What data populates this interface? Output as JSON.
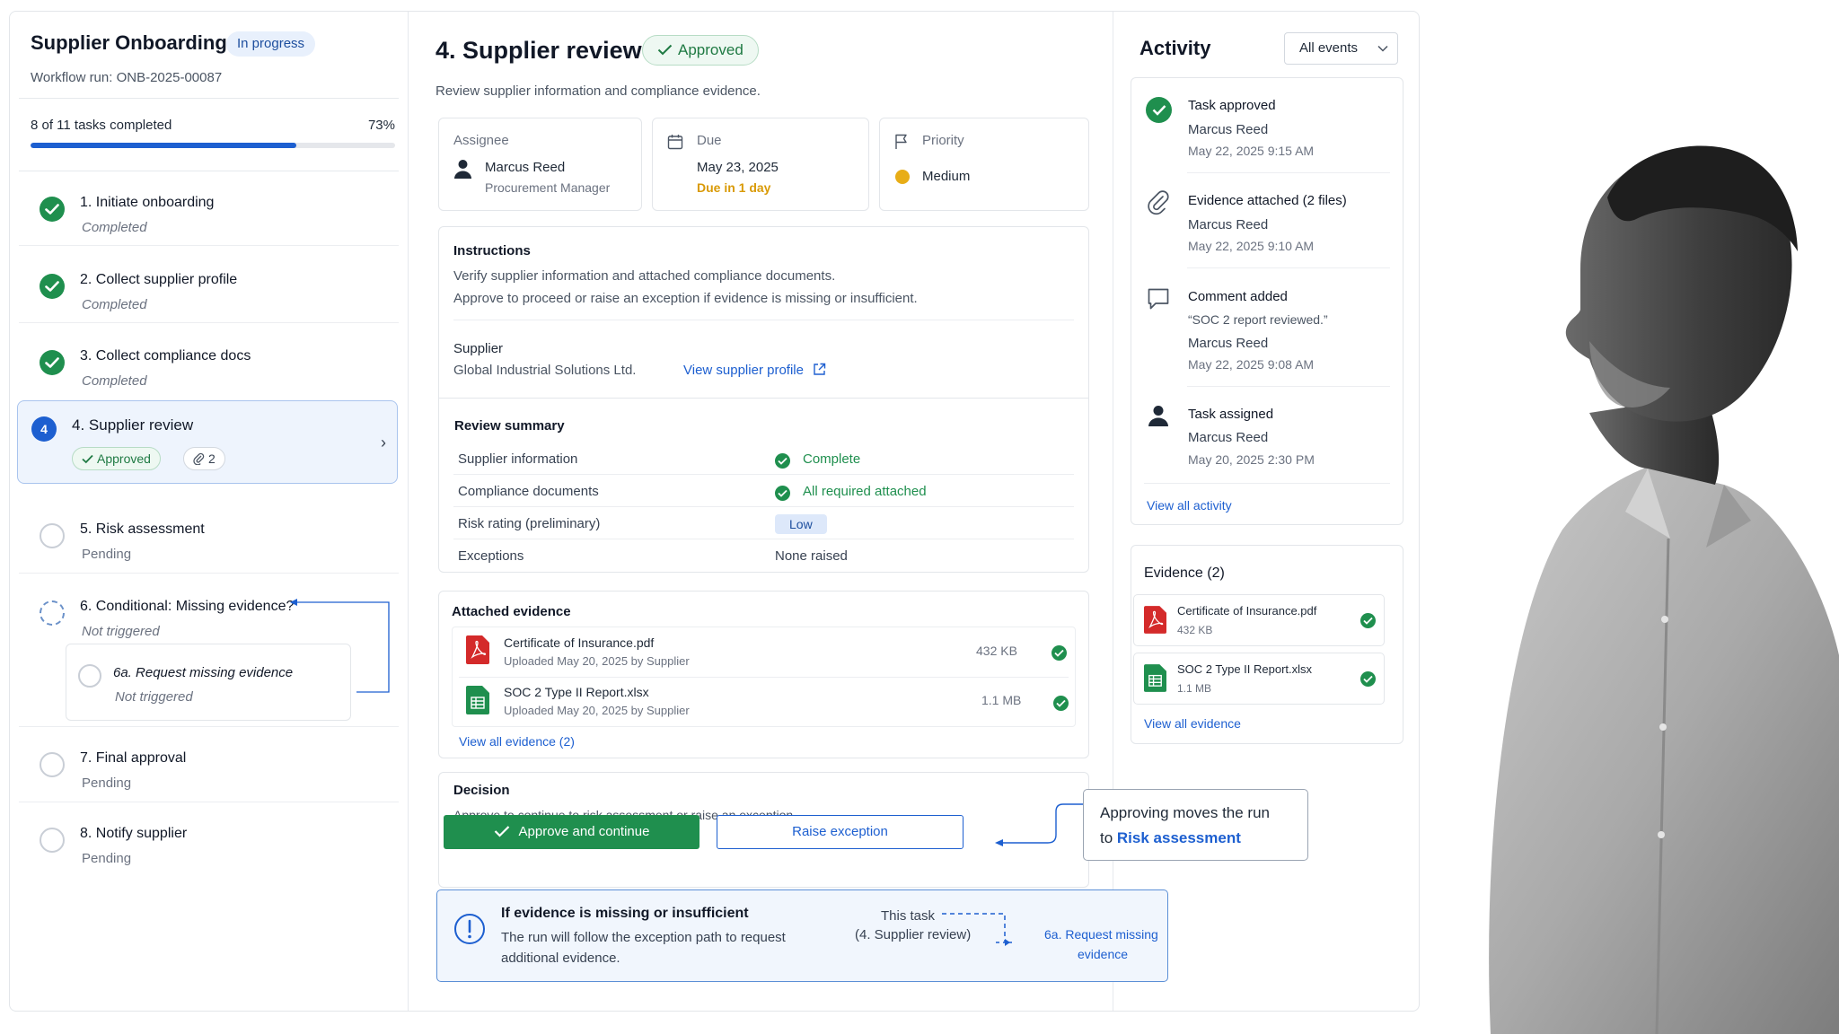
{
  "workflow": {
    "title": "Supplier Onboarding",
    "status": "In progress",
    "run": "Workflow run: ONB-2025-00087",
    "progress_label": "8 of 11 tasks completed",
    "progress_pct": "73%",
    "progress_value": 0.73
  },
  "steps": [
    {
      "title": "1. Initiate onboarding",
      "status": "Completed"
    },
    {
      "title": "2. Collect supplier profile",
      "status": "Completed"
    },
    {
      "title": "3. Collect compliance docs",
      "status": "Completed"
    },
    {
      "title": "4. Supplier review",
      "num": "4",
      "chip": "Approved",
      "attach": "2"
    },
    {
      "title": "5. Risk assessment",
      "status": "Pending"
    },
    {
      "title": "6. Conditional: Missing evidence?",
      "status": "Not triggered"
    },
    {
      "title": "6a. Request missing evidence",
      "status": "Not triggered"
    },
    {
      "title": "7. Final approval",
      "status": "Pending"
    },
    {
      "title": "8. Notify supplier",
      "status": "Pending"
    }
  ],
  "task": {
    "title": "4. Supplier review",
    "status": "Approved",
    "description": "Review supplier information and compliance evidence.",
    "assignee_label": "Assignee",
    "assignee_name": "Marcus Reed",
    "assignee_role": "Procurement Manager",
    "due_label": "Due",
    "due_date": "May 23, 2025",
    "due_in": "Due in 1 day",
    "priority_label": "Priority",
    "priority": "Medium",
    "instructions_title": "Instructions",
    "instructions_1": "Verify supplier information and attached compliance documents.",
    "instructions_2": "Approve to proceed or raise an exception if evidence is missing or insufficient.",
    "supplier_label": "Supplier",
    "supplier_name": "Global Industrial Solutions Ltd.",
    "supplier_link": "View supplier profile",
    "summary_title": "Review summary",
    "summary": [
      {
        "k": "Supplier information",
        "v": "Complete"
      },
      {
        "k": "Compliance documents",
        "v": "All required attached"
      },
      {
        "k": "Risk rating (preliminary)",
        "v": "Low"
      },
      {
        "k": "Exceptions",
        "v": "None raised"
      }
    ],
    "evidence_title": "Attached evidence",
    "evidence": [
      {
        "name": "Certificate of Insurance.pdf",
        "meta": "Uploaded May 20, 2025 by Supplier",
        "size": "432 KB"
      },
      {
        "name": "SOC 2 Type II Report.xlsx",
        "meta": "Uploaded May 20, 2025 by Supplier",
        "size": "1.1 MB"
      }
    ],
    "evidence_link": "View all evidence (2)",
    "decision_title": "Decision",
    "decision_desc": "Approve to continue to risk assessment or raise an exception.",
    "approve_btn": "Approve and continue",
    "raise_btn": "Raise exception"
  },
  "callout": {
    "line1": "Approving moves the run",
    "line2_prefix": "to ",
    "line2_link": "Risk assessment"
  },
  "note": {
    "title": "If evidence is missing or insufficient",
    "body_1": "The run will follow the exception path to request",
    "body_2": "additional evidence.",
    "this_task_1": "This task",
    "this_task_2": "(4. Supplier review)",
    "target_1": "6a. Request missing",
    "target_2": "evidence"
  },
  "activity": {
    "title": "Activity",
    "filter": "All events",
    "items": [
      {
        "title": "Task approved",
        "user": "Marcus Reed",
        "time": "May 22, 2025 9:15 AM",
        "icon": "check-circle-icon"
      },
      {
        "title": "Evidence attached (2 files)",
        "user": "Marcus Reed",
        "time": "May 22, 2025 9:10 AM",
        "icon": "paperclip-icon"
      },
      {
        "title": "Comment added",
        "quote": "“SOC 2 report reviewed.”",
        "user": "Marcus Reed",
        "time": "May 22, 2025 9:08 AM",
        "icon": "comment-icon"
      },
      {
        "title": "Task assigned",
        "user": "Marcus Reed",
        "time": "May 20, 2025 2:30 PM",
        "icon": "person-icon"
      }
    ],
    "link": "View all activity"
  },
  "evidence_panel": {
    "title": "Evidence (2)",
    "items": [
      {
        "name": "Certificate of Insurance.pdf",
        "size": "432 KB"
      },
      {
        "name": "SOC 2 Type II Report.xlsx",
        "size": "1.1 MB"
      }
    ],
    "link": "View all evidence"
  },
  "colors": {
    "primary": "#1d5fd0",
    "success": "#1f8f4e",
    "warning": "#e0a800",
    "pdf": "#d42a2a",
    "sheet": "#1f8f4e"
  }
}
